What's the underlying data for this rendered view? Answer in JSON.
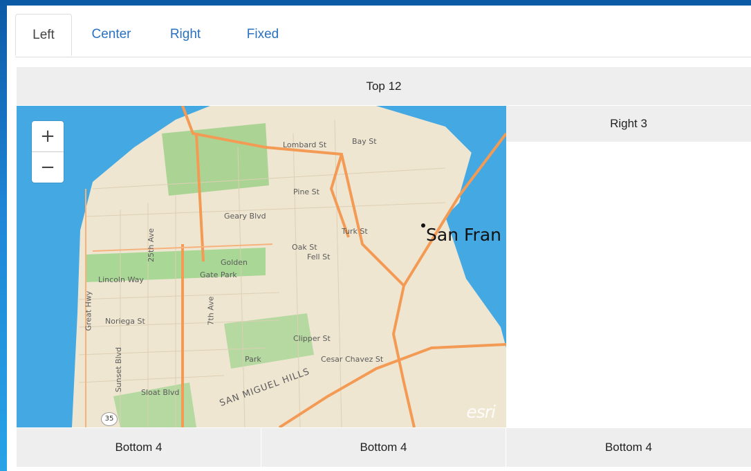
{
  "tabs": [
    {
      "label": "Left"
    },
    {
      "label": "Center"
    },
    {
      "label": "Right"
    },
    {
      "label": "Fixed"
    }
  ],
  "layout": {
    "top": "Top 12",
    "right": "Right 3",
    "bottom": [
      "Bottom 4",
      "Bottom 4",
      "Bottom 4"
    ]
  },
  "map": {
    "zoom_in": "+",
    "zoom_out": "−",
    "place_label": "San Fran",
    "attribution": "esri",
    "streets": [
      "Lombard St",
      "Bay St",
      "Pine St",
      "Geary Blvd",
      "Golden",
      "Gate Park",
      "Lincoln Way",
      "Noriega St",
      "Sloat Blvd",
      "Clipper St",
      "Cesar Chavez St",
      "Oak St",
      "Fell St",
      "Turk St",
      "SAN MIGUEL HILLS",
      "7th Ave",
      "25th Ave",
      "Sunset Blvd",
      "Great Hwy",
      "Park"
    ],
    "route_badge": "35"
  },
  "colors": {
    "accent": "#2a72c0",
    "cell_bg": "#eeeeee",
    "water": "#44a9e3",
    "land": "#efe6d2",
    "park": "#9fd08a",
    "road": "#f39a55"
  }
}
